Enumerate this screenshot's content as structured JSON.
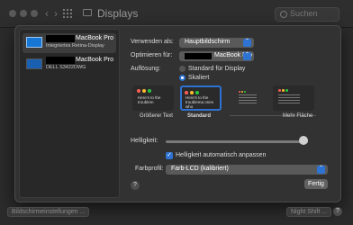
{
  "window": {
    "title": "Displays",
    "search_placeholder": "Suchen",
    "nav_back": "‹",
    "nav_forward": "›"
  },
  "sidebar": {
    "displays": [
      {
        "name": "MacBook Pro",
        "subtitle": "Integriertes Retina-Display",
        "selected": true
      },
      {
        "name": "MacBook Pro",
        "subtitle": "DELL S3422DWG",
        "selected": false
      }
    ]
  },
  "settings": {
    "use_as_label": "Verwenden als:",
    "use_as_value": "Hauptbildschirm",
    "optimize_label": "Optimieren für:",
    "optimize_value": "MacBook Pro",
    "resolution_label": "Auflösung:",
    "resolution_options": [
      "Standard für Display",
      "Skaliert"
    ],
    "resolution_selected": "Skaliert",
    "scale_options": [
      {
        "caption": "Größerer Text",
        "preview_text": "Here's to the troublem",
        "selected": false
      },
      {
        "caption": "Standard",
        "preview_text": "Here's to the troublema ones who",
        "selected": true
      },
      {
        "caption": "",
        "preview_text": "",
        "selected": false
      },
      {
        "caption": "Mehr Fläche",
        "preview_text": "",
        "selected": false
      }
    ],
    "brightness_label": "Helligkeit:",
    "brightness_level": 0.97,
    "auto_brightness_label": "Helligkeit automatisch anpassen",
    "auto_brightness_checked": true,
    "color_profile_label": "Farbprofil:",
    "color_profile_value": "Farb-LCD (kalibriert)",
    "help_label": "?",
    "done_button": "Fertig"
  },
  "footer": {
    "left_button": "Bildschirmeinstellungen ...",
    "right_button": "Night Shift ...",
    "help_label": "?"
  },
  "colors": {
    "accent": "#2e72d2",
    "traffic_red": "#ff5f57",
    "traffic_yellow": "#febc2e",
    "traffic_green": "#28c840"
  }
}
